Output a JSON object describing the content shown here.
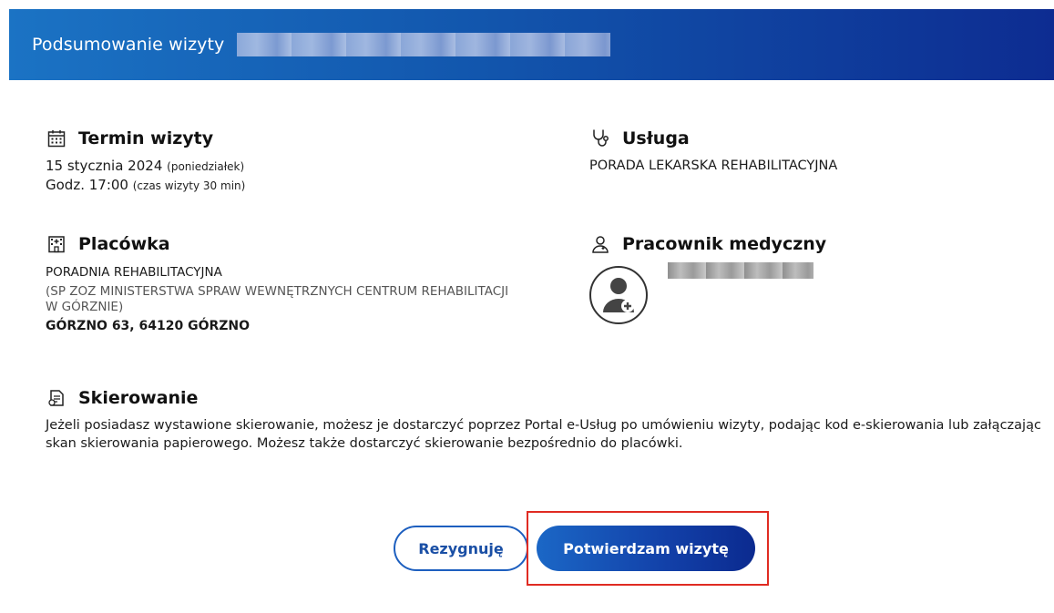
{
  "header": {
    "title": "Podsumowanie wizyty"
  },
  "termin": {
    "heading": "Termin wizyty",
    "date": "15 stycznia 2024",
    "weekday": "(poniedziałek)",
    "time": "Godz. 17:00",
    "duration": "(czas wizyty 30 min)"
  },
  "usluga": {
    "heading": "Usługa",
    "value": "PORADA LEKARSKA REHABILITACYJNA"
  },
  "placowka": {
    "heading": "Placówka",
    "name": "PORADNIA REHABILITACYJNA",
    "org_line1": "(SP ZOZ MINISTERSTWA SPRAW WEWNĘTRZNYCH CENTRUM REHABILITACJI",
    "org_line2": "W GÓRZNIE)",
    "address": "GÓRZNO 63, 64120 GÓRZNO"
  },
  "pracownik": {
    "heading": "Pracownik medyczny"
  },
  "skierowanie": {
    "heading": "Skierowanie",
    "line1": "Jeżeli posiadasz wystawione skierowanie, możesz je dostarczyć poprzez Portal e-Usług po umówieniu wizyty, podając kod e-skierowania lub załączając",
    "line2": "skan skierowania papierowego. Możesz także dostarczyć skierowanie bezpośrednio do placówki."
  },
  "actions": {
    "cancel_label": "Rezygnuję",
    "confirm_label": "Potwierdzam wizytę"
  },
  "colors": {
    "header_start": "#1b73c4",
    "header_end": "#0d2c91",
    "button_primary": "#1240a8",
    "highlight": "#e02b22"
  }
}
